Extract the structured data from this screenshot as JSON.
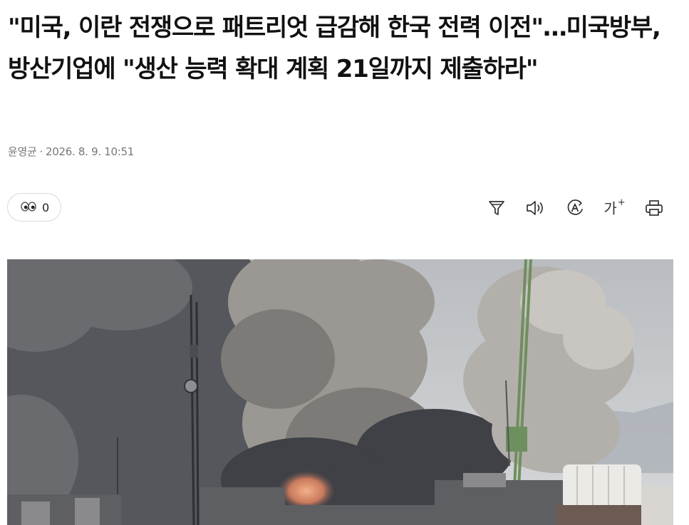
{
  "article": {
    "headline": "\"미국, 이란 전쟁으로 패트리엇 급감해 한국 전력 이전\"…미국방부, 방산기업에 \"생산 능력 확대 계획 21일까지 제출하라\"",
    "author": "윤영균",
    "separator": "·",
    "datetime": "2026. 8. 9. 10:51"
  },
  "reactions": {
    "icon": "eyes-emoji-icon",
    "count": "0"
  },
  "toolbar": {
    "icons": [
      "summary-filter-icon",
      "audio-speaker-icon",
      "translate-a-icon",
      "font-size-icon",
      "print-icon"
    ],
    "font_size_label": "가",
    "font_size_plus": "+"
  },
  "photo": {
    "subject": "smoke plumes over city buildings with antenna tower and crane"
  },
  "colors": {
    "text_primary": "#111111",
    "text_meta": "#777777",
    "border": "#d9d9d9",
    "icon": "#333333",
    "sky": "#c9cdd2",
    "smoke_dark": "#4c4e53",
    "smoke_light": "#a9a7a3",
    "crane_green": "#6e8f5e"
  }
}
